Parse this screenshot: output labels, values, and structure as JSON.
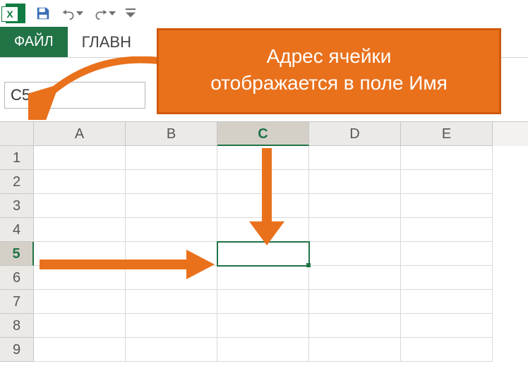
{
  "qat": {
    "save_title": "Сохранить",
    "undo_title": "Отменить",
    "redo_title": "Вернуть"
  },
  "tabs": {
    "file": "ФАЙЛ",
    "home_partial": "ГЛАВН"
  },
  "name_box": {
    "value": "C5"
  },
  "columns": [
    "A",
    "B",
    "C",
    "D",
    "E"
  ],
  "active_column_index": 2,
  "rows": [
    "1",
    "2",
    "3",
    "4",
    "5",
    "6",
    "7",
    "8",
    "9"
  ],
  "active_row_index": 4,
  "callout": {
    "line1": "Адрес ячейки",
    "line2": "отображается в поле Имя"
  }
}
